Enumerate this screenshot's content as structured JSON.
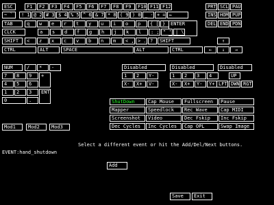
{
  "keyboard": {
    "row_fn": [
      "ESC",
      "F1",
      "F2",
      "F3",
      "F4",
      "F5",
      "F6",
      "F7",
      "F8",
      "F9",
      "F10",
      "F11",
      "F12"
    ],
    "row_num": [
      "~ `",
      "! 1",
      "@ 2",
      "# 3",
      "$ 4",
      "% 5",
      "^ 6",
      "& 7",
      "* 8",
      "( 9",
      ") 0",
      "_ -",
      "+ =",
      "←"
    ],
    "row_q": [
      "TAB",
      "q",
      "w",
      "e",
      "r",
      "t",
      "y",
      "u",
      "i",
      "o",
      "p",
      "{ [",
      "} ]",
      "ENTER"
    ],
    "row_a": [
      "CLCK",
      "a",
      "s",
      "d",
      "f",
      "g",
      "h",
      "j",
      "k",
      "l",
      ": ;",
      "\" '",
      "| \\"
    ],
    "row_z": [
      "SHIFT",
      "<",
      "z",
      "x",
      "c",
      "v",
      "b",
      "n",
      "m",
      "< ,",
      "> .",
      "? /",
      "SHIFT"
    ],
    "row_ctrl": [
      "CTRL",
      "ALT",
      "SPACE",
      "ALT",
      "CTRL"
    ],
    "nav_top": [
      "PRT",
      "SCL",
      "PAU"
    ],
    "nav_mid": [
      "INS",
      "HOM",
      "PUP"
    ],
    "nav_bot": [
      "DEL",
      "END",
      "PDN"
    ],
    "arrows": {
      "up": "↑",
      "left": "←",
      "down": "↓",
      "right": "→"
    }
  },
  "numpad": {
    "r1": [
      "NUM",
      "/",
      "*",
      "-"
    ],
    "r2": [
      "7",
      "8",
      "9",
      "+"
    ],
    "r3": [
      "4",
      "5",
      "6"
    ],
    "r4": [
      "1",
      "2",
      "3",
      "ENT"
    ],
    "r5": [
      "0",
      "."
    ]
  },
  "joy_groups": [
    {
      "title": "Disabled",
      "r1": [
        "1",
        "2"
      ],
      "r2": [
        "X-",
        "X+"
      ]
    },
    {
      "title": "Disabled",
      "r1": [
        "1",
        "2",
        "3",
        "4"
      ],
      "r2": [
        "X-",
        "X+",
        "Y-",
        "Y+"
      ]
    },
    {
      "title": "Disabled",
      "r1": [
        "UP"
      ],
      "r2": [
        "LFT",
        "DWN",
        "RGT"
      ]
    }
  ],
  "joy_lower": [
    {
      "r1": [
        "Y-",
        "V-"
      ],
      "r2": []
    },
    {
      "r1": [],
      "r2": []
    }
  ],
  "events": [
    [
      "ShutDown",
      "Cap Mouse",
      "Fullscreen",
      "Pause"
    ],
    [
      "Mapper",
      "Speedlock",
      "Rec Wave",
      "Cap MIDI"
    ],
    [
      "Screenshot",
      "Video",
      "Dec Fskip",
      "Inc Fskip"
    ],
    [
      "Dec Cycles",
      "Inc Cycles",
      "Cap OPL",
      "Swap Image"
    ]
  ],
  "mods": [
    "Mod1",
    "Mod2",
    "Mod3"
  ],
  "message": "Select a different event or hit the Add/Del/Next buttons.",
  "event_label": "EVENT:hand_shutdown",
  "buttons": {
    "add": "Add",
    "save": "Save",
    "exit": "Exit"
  },
  "colors": {
    "selected": "#2aff2a",
    "fg": "#ffffff",
    "bg": "#000000"
  }
}
